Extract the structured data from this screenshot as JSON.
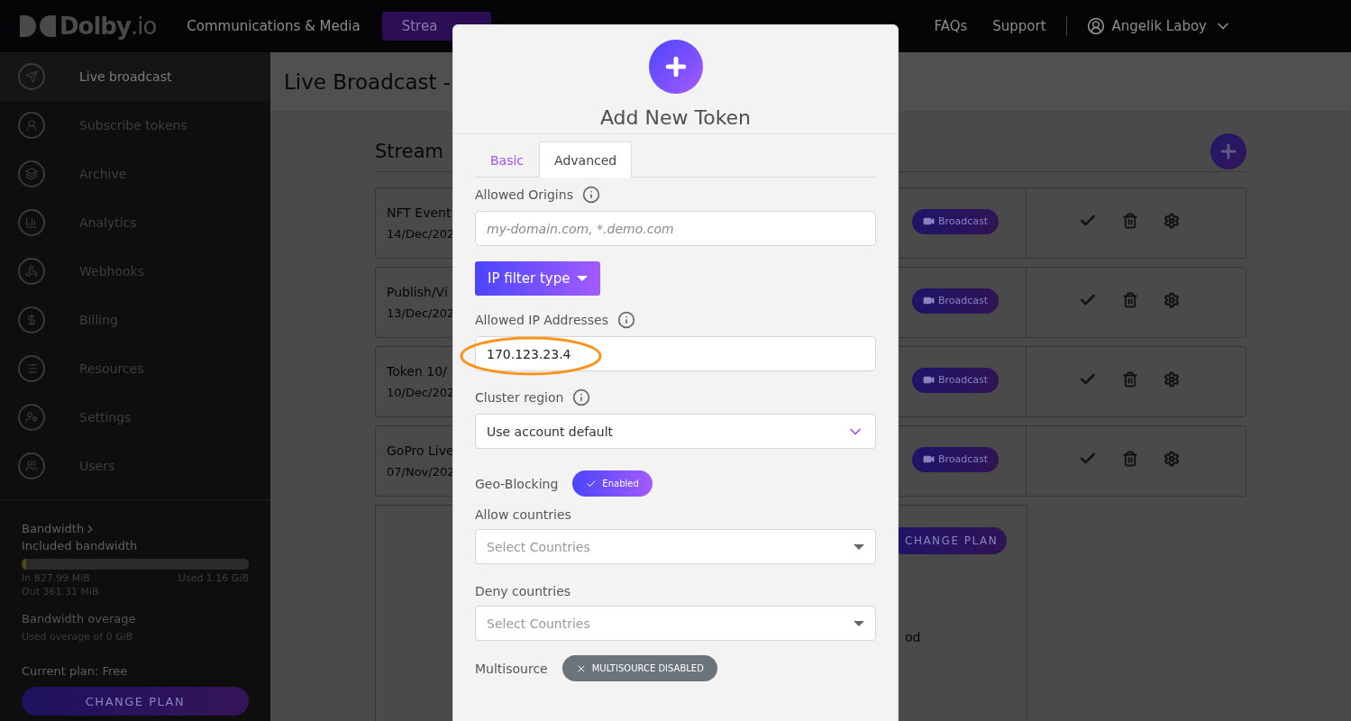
{
  "header": {
    "logo": "**Dolby**.io",
    "nav": [
      {
        "label": "Communications & Media",
        "selected": false
      },
      {
        "label": "Strea",
        "selected": true
      }
    ],
    "links": [
      "FAQs",
      "Support"
    ],
    "user": "Angelik Laboy"
  },
  "sidebar": {
    "items": [
      {
        "label": "Live broadcast",
        "selected": true
      },
      {
        "label": "Subscribe tokens",
        "selected": false
      },
      {
        "label": "Archive",
        "selected": false
      },
      {
        "label": "Analytics",
        "selected": false
      },
      {
        "label": "Webhooks",
        "selected": false
      },
      {
        "label": "Billing",
        "selected": false
      },
      {
        "label": "Resources",
        "selected": false
      },
      {
        "label": "Settings",
        "selected": false
      },
      {
        "label": "Users",
        "selected": false
      }
    ],
    "bandwidth": {
      "title": "Bandwidth",
      "subtitle": "Included bandwidth",
      "level": 0.02,
      "in": "In 827.99 MiB",
      "used": "Used 1.16 GiB",
      "out": "Out 361.31 MiB"
    },
    "overage": {
      "title": "Bandwidth overage",
      "text": "Used overage of 0 GiB"
    },
    "plan": "Current plan: Free",
    "change_plan": "CHANGE PLAN"
  },
  "main": {
    "title": "Live Broadcast -",
    "section_title": "Stream",
    "rows": [
      {
        "name": "NFT Event",
        "date": "14/Dec/202",
        "action": "Broadcast"
      },
      {
        "name": "Publish/Vi",
        "date": "13/Dec/202",
        "action": "Broadcast"
      },
      {
        "name": "Token 10/",
        "date": "10/Dec/202",
        "action": "Broadcast"
      },
      {
        "name": "GoPro Live",
        "date": "07/Nov/202",
        "action": "Broadcast"
      }
    ],
    "plan_card": {
      "button": "CHANGE PLAN",
      "text": "od"
    }
  },
  "modal": {
    "title": "Add New Token",
    "tabs": [
      {
        "label": "Basic",
        "selected": false
      },
      {
        "label": "Advanced",
        "selected": true
      }
    ],
    "allowed_origins": {
      "label": "Allowed Origins",
      "placeholder": "my-domain.com, *.demo.com"
    },
    "ip_filter_button": "IP filter type",
    "allowed_ips": {
      "label": "Allowed IP Addresses",
      "value": "170.123.23.4",
      "highlighted": true
    },
    "cluster_region": {
      "label": "Cluster region",
      "value": "Use account default"
    },
    "geo_blocking": {
      "label": "Geo-Blocking",
      "enabled": true,
      "pill": "Enabled"
    },
    "allow_countries": {
      "label": "Allow countries",
      "placeholder": "Select Countries"
    },
    "deny_countries": {
      "label": "Deny countries",
      "placeholder": "Select Countries"
    },
    "multisource": {
      "label": "Multisource",
      "enabled": false,
      "pill": "MULTISOURCE DISABLED"
    }
  }
}
